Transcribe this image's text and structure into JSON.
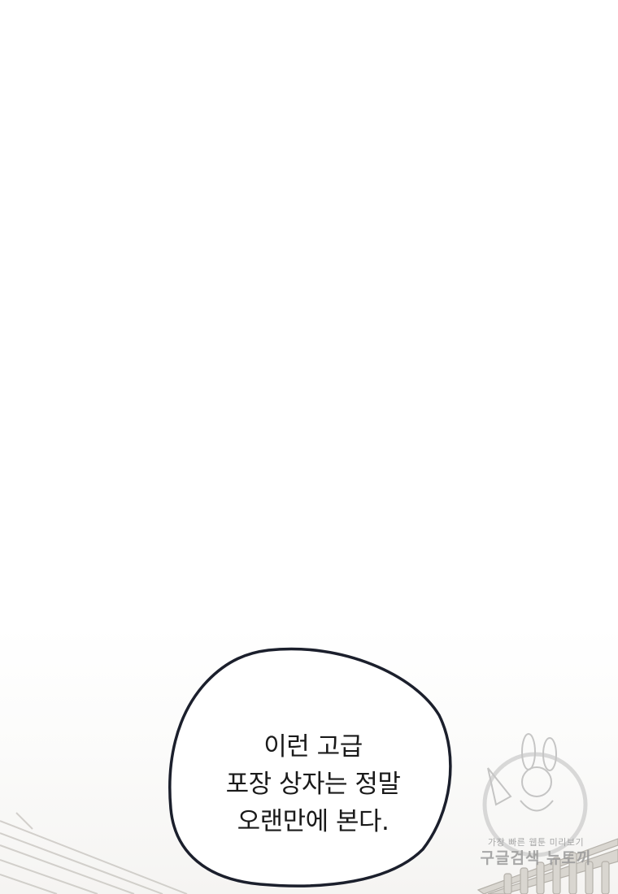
{
  "speech_bubble": {
    "lines": [
      "이런 고급",
      "포장 상자는 정말",
      "오랜만에 본다."
    ]
  },
  "watermark": {
    "line1": "가장 빠른 웹툰 미리보기",
    "line2": "구글검색 뉴토끼"
  }
}
